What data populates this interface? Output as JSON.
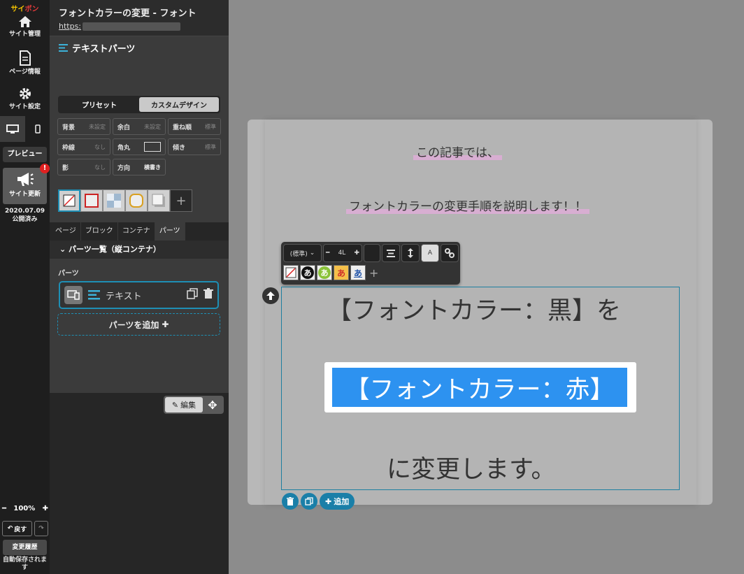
{
  "rail": {
    "logo_a": "サイ",
    "logo_b": "ポン",
    "site_admin": "サイト管理",
    "page_info": "ページ情報",
    "site_settings": "サイト設定",
    "preview": "プレビュー",
    "site_update": "サイト更新",
    "update_badge": "!",
    "pub_date": "2020.07.09",
    "pub_status": "公開済み",
    "zoom": "100%",
    "undo": "戻す",
    "history": "変更履歴",
    "autosave": "自動保存されます"
  },
  "panel": {
    "page_title": "フォントカラーの変更 - フォント",
    "page_url": "https:",
    "parts_title": "テキストパーツ",
    "preset_tabs": [
      "プリセット",
      "カスタムデザイン"
    ],
    "props": {
      "bg": {
        "k": "背景",
        "v": "未設定"
      },
      "margin": {
        "k": "余白",
        "v": "未設定"
      },
      "zorder": {
        "k": "重ね順",
        "v": "標準"
      },
      "border": {
        "k": "枠線",
        "v": "なし"
      },
      "radius": {
        "k": "角丸",
        "v": ""
      },
      "tilt": {
        "k": "傾き",
        "v": "標準"
      },
      "shadow": {
        "k": "影",
        "v": "なし"
      },
      "direction": {
        "k": "方向",
        "v": "横書き"
      }
    },
    "tabs": [
      "ページ",
      "ブロック",
      "コンテナ",
      "パーツ"
    ],
    "list_head": "パーツ一覧（縦コンテナ）",
    "sub_label": "パーツ",
    "part_name": "テキスト",
    "add_parts": "パーツを追加",
    "edit": "編集"
  },
  "canvas": {
    "line1": "この記事では、",
    "line2": "フォントカラーの変更手順を説明します！！",
    "toolbar": {
      "size_select": "(標準)",
      "line_height": "4L",
      "color_a": "A",
      "glyph": "あ"
    },
    "big_black": "【フォントカラー：黒】を",
    "big_red": "【フォントカラー：赤】",
    "big_black2": "に変更します。",
    "add": "追加"
  },
  "colors": {
    "accent": "#1e8fb5",
    "selection": "#2d92f0",
    "badge": "#e02020",
    "highlight": "#d8aed2"
  }
}
